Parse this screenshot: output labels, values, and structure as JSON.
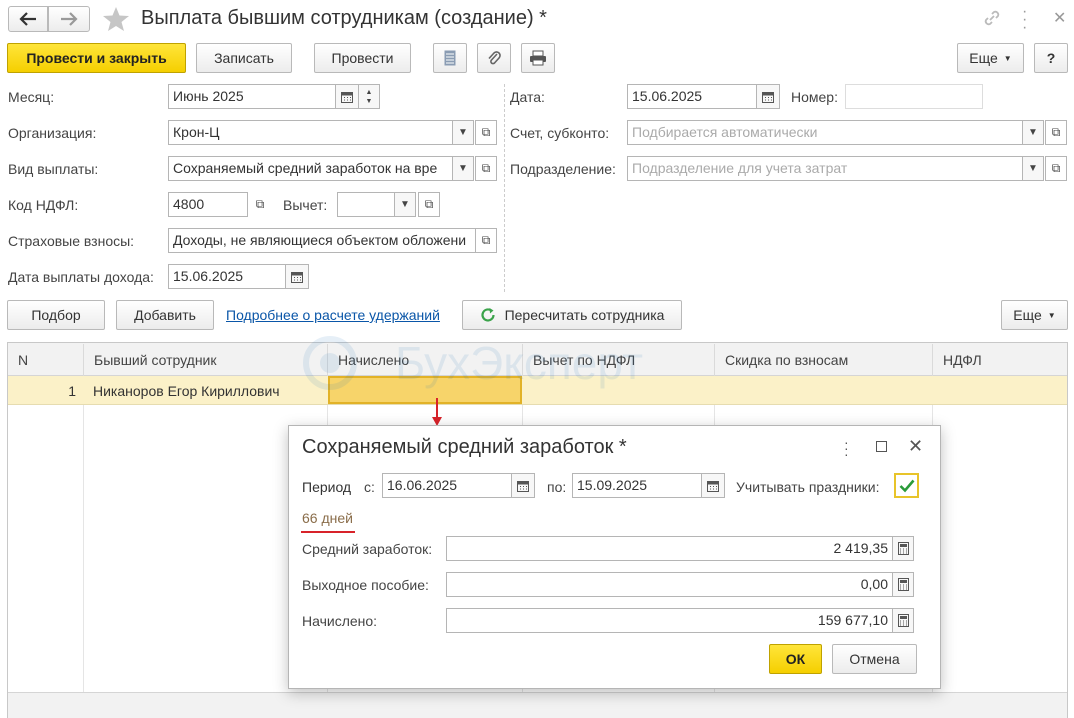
{
  "window": {
    "title": "Выплата бывшим сотрудникам (создание) *"
  },
  "toolbar": {
    "post_close": "Провести и закрыть",
    "save": "Записать",
    "post": "Провести",
    "more": "Еще",
    "help": "?"
  },
  "form": {
    "month_label": "Месяц:",
    "month_value": "Июнь 2025",
    "org_label": "Организация:",
    "org_value": "Крон-Ц",
    "pay_type_label": "Вид выплаты:",
    "pay_type_value": "Сохраняемый средний заработок на вре",
    "ndfl_code_label": "Код НДФЛ:",
    "ndfl_code_value": "4800",
    "deduction_label": "Вычет:",
    "deduction_value": "",
    "insurance_label": "Страховые взносы:",
    "insurance_value": "Доходы, не являющиеся объектом обложени",
    "income_date_label": "Дата выплаты дохода:",
    "income_date_value": "15.06.2025",
    "date_label": "Дата:",
    "date_value": "15.06.2025",
    "number_label": "Номер:",
    "number_value": "",
    "account_label": "Счет, субконто:",
    "account_placeholder": "Подбирается автоматически",
    "division_label": "Подразделение:",
    "division_placeholder": "Подразделение для учета затрат"
  },
  "table_toolbar": {
    "select": "Подбор",
    "add": "Добавить",
    "link": "Подробнее о расчете удержаний",
    "recalc": "Пересчитать сотрудника",
    "more": "Еще"
  },
  "table": {
    "columns": [
      "N",
      "Бывший сотрудник",
      "Начислено",
      "Вычет по НДФЛ",
      "Скидка по взносам",
      "НДФЛ"
    ],
    "rows": [
      {
        "n": "1",
        "employee": "Никаноров Егор Кириллович",
        "accrued": "",
        "deduction": "",
        "discount": "",
        "ndfl": ""
      }
    ]
  },
  "watermark": "БухЭксперт",
  "dialog": {
    "title": "Сохраняемый средний заработок *",
    "period_label": "Период",
    "from_label": "с:",
    "from_value": "16.06.2025",
    "to_label": "по:",
    "to_value": "15.09.2025",
    "holidays_label": "Учитывать праздники:",
    "holidays_checked": true,
    "days": "66 дней",
    "avg_label": "Средний заработок:",
    "avg_value": "2 419,35",
    "severance_label": "Выходное пособие:",
    "severance_value": "0,00",
    "accrued_label": "Начислено:",
    "accrued_value": "159 677,10",
    "ok": "ОК",
    "cancel": "Отмена"
  },
  "colors": {
    "accent_yellow": "#f5cf00",
    "selected_row": "#fbf1c8",
    "selected_cell": "#f7d46a",
    "link": "#0a56a8",
    "red_marker": "#d8232a",
    "check_green": "#2a9b3a"
  }
}
